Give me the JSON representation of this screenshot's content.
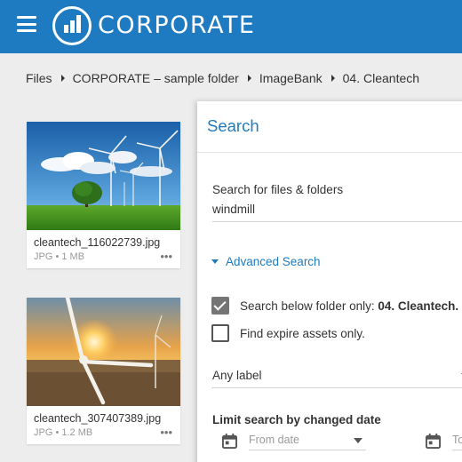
{
  "header": {
    "brand": "CORPORATE",
    "menu_icon": "hamburger-menu-icon",
    "logo_icon": "bar-chart-logo-icon",
    "color": "#1e7bc1"
  },
  "breadcrumb": [
    "Files",
    "CORPORATE – sample folder",
    "ImageBank",
    "04. Cleantech"
  ],
  "files": [
    {
      "name": "cleantech_116022739.jpg",
      "meta": "JPG • 1 MB",
      "more": "•••",
      "thumbnail": "windmill-field-thumbnail"
    },
    {
      "name": "cleantech_307407389.jpg",
      "meta": "JPG • 1.2 MB",
      "more": "•••",
      "thumbnail": "windmill-sunset-thumbnail"
    }
  ],
  "search": {
    "title": "Search",
    "query_label": "Search for files & folders",
    "query_value": "windmill",
    "advanced_label": "Advanced Search",
    "below_folder_prefix": "Search below folder only: ",
    "below_folder_name": "04. Cleantech.",
    "below_folder_checked": true,
    "expire_label": "Find expire assets only.",
    "expire_checked": false,
    "label_select": "Any label",
    "date_label": "Limit search by changed date",
    "from_placeholder": "From date",
    "to_placeholder": "To"
  }
}
